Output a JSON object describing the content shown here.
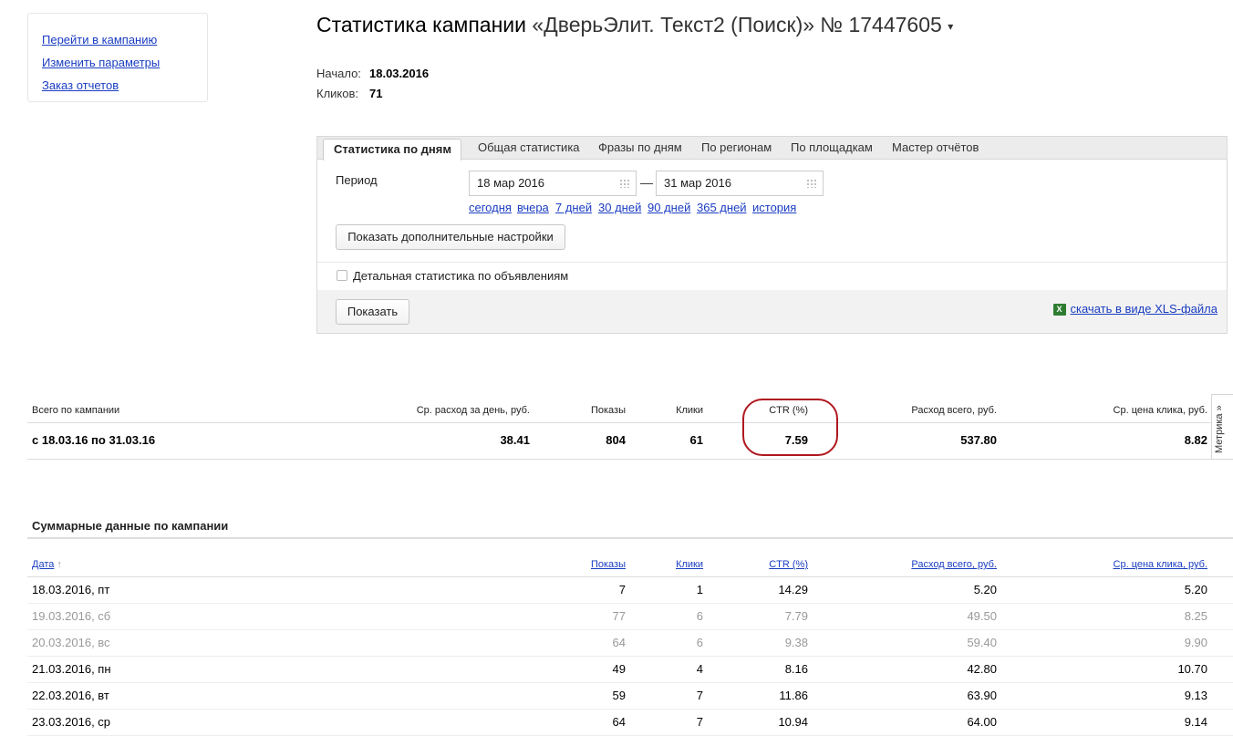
{
  "side_links": [
    "Перейти в кампанию",
    "Изменить параметры",
    "Заказ отчетов"
  ],
  "title": {
    "prefix": "Статистика кампании",
    "campaign": "«ДверьЭлит. Текст2 (Поиск)» № 17447605",
    "arrow": "▾"
  },
  "meta": {
    "start_label": "Начало:",
    "start_value": "18.03.2016",
    "clicks_label": "Кликов:",
    "clicks_value": "71"
  },
  "tabs": [
    "Статистика по дням",
    "Общая статистика",
    "Фразы по дням",
    "По регионам",
    "По площадкам",
    "Мастер отчётов"
  ],
  "filters": {
    "period_label": "Период",
    "date_from": "18 мар 2016",
    "date_to": "31 мар 2016",
    "dash": "—",
    "quick_links": [
      "сегодня",
      "вчера",
      "7 дней",
      "30 дней",
      "90 дней",
      "365 дней",
      "история"
    ],
    "more_settings_button": "Показать дополнительные настройки",
    "detail_checkbox_label": "Детальная статистика по объявлениям",
    "show_button": "Показать",
    "xls_link": "скачать в виде XLS-файла",
    "xls_icon_text": "X"
  },
  "totals": {
    "headers": [
      "Всего по кампании",
      "Ср. расход за день, руб.",
      "Показы",
      "Клики",
      "CTR (%)",
      "Расход всего, руб.",
      "Ср. цена клика, руб."
    ],
    "period": "с 18.03.16 по 31.03.16",
    "avg_daily": "38.41",
    "shows": "804",
    "clicks": "61",
    "ctr": "7.59",
    "spend": "537.80",
    "avg_cpc": "8.82"
  },
  "metrika_tab": "Метрика »",
  "summary": {
    "title": "Суммарные данные по кампании",
    "headers": [
      "Дата",
      "Показы",
      "Клики",
      "CTR (%)",
      "Расход всего, руб.",
      "Ср. цена клика, руб."
    ],
    "sort_arrow": "↑",
    "rows": [
      {
        "date": "18.03.2016, пт",
        "shows": "7",
        "clicks": "1",
        "ctr": "14.29",
        "spend": "5.20",
        "cpc": "5.20",
        "weekend": false
      },
      {
        "date": "19.03.2016, сб",
        "shows": "77",
        "clicks": "6",
        "ctr": "7.79",
        "spend": "49.50",
        "cpc": "8.25",
        "weekend": true
      },
      {
        "date": "20.03.2016, вс",
        "shows": "64",
        "clicks": "6",
        "ctr": "9.38",
        "spend": "59.40",
        "cpc": "9.90",
        "weekend": true
      },
      {
        "date": "21.03.2016, пн",
        "shows": "49",
        "clicks": "4",
        "ctr": "8.16",
        "spend": "42.80",
        "cpc": "10.70",
        "weekend": false
      },
      {
        "date": "22.03.2016, вт",
        "shows": "59",
        "clicks": "7",
        "ctr": "11.86",
        "spend": "63.90",
        "cpc": "9.13",
        "weekend": false
      },
      {
        "date": "23.03.2016, ср",
        "shows": "64",
        "clicks": "7",
        "ctr": "10.94",
        "spend": "64.00",
        "cpc": "9.14",
        "weekend": false
      }
    ]
  },
  "colors": {
    "link": "#1a3dc1",
    "highlight_circle": "#b0181f",
    "weekend_text": "#999999"
  }
}
